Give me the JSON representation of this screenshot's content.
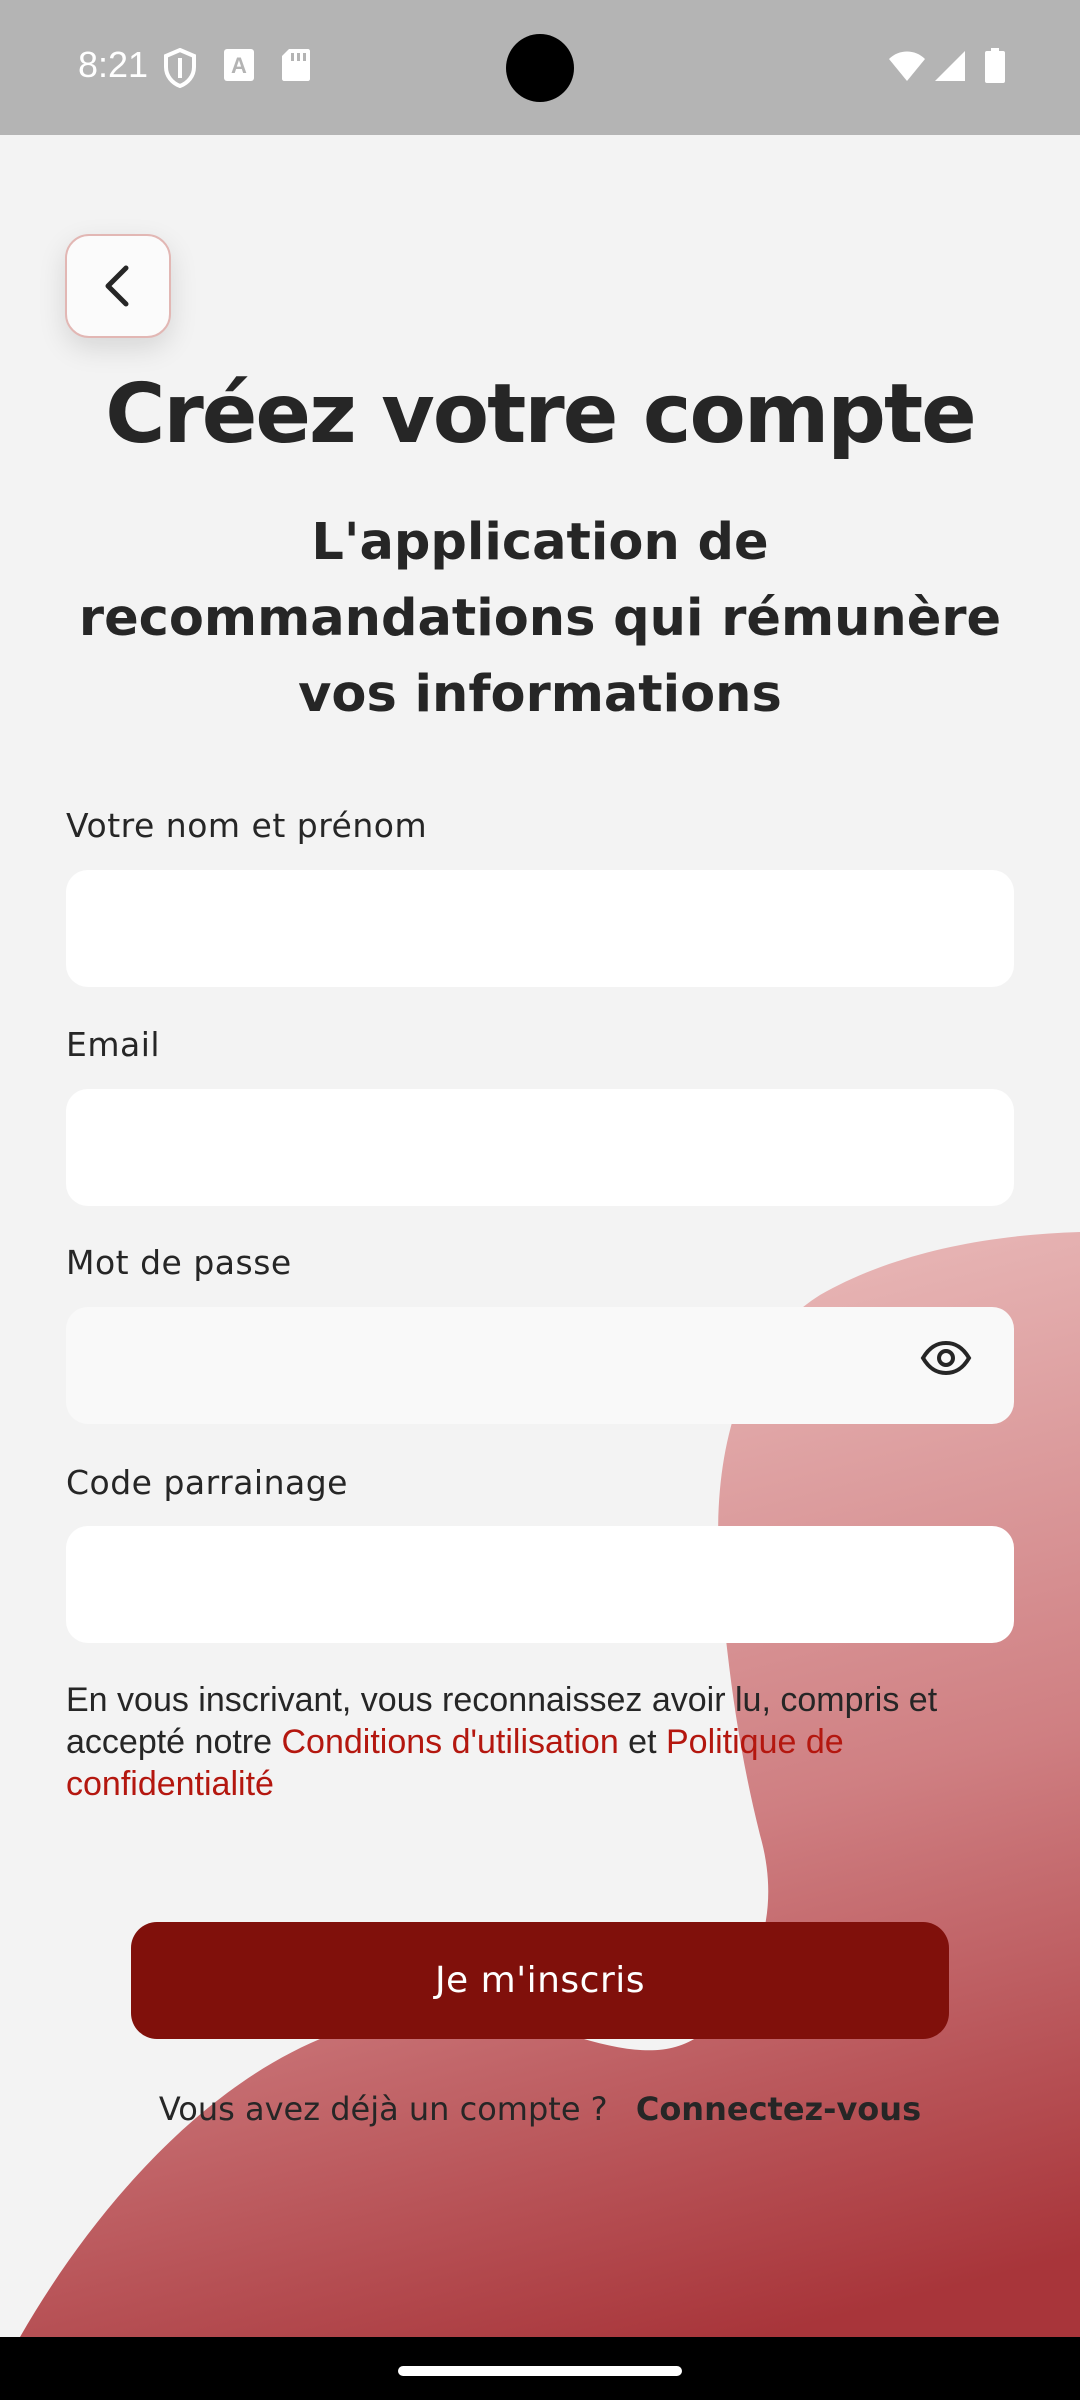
{
  "status_bar": {
    "time": "8:21",
    "left_icons": [
      "shield-icon",
      "keyboard-a-icon",
      "sd-card-icon"
    ],
    "right_icons": [
      "wifi-icon",
      "signal-icon",
      "battery-icon"
    ]
  },
  "header": {
    "back_icon": "chevron-left-icon",
    "title": "Créez votre compte",
    "subtitle": "L'application de recommandations qui rémunère vos informations"
  },
  "form": {
    "name_label": "Votre nom et prénom",
    "name_value": "",
    "email_label": "Email",
    "email_value": "",
    "password_label": "Mot de passe",
    "password_value": "",
    "password_toggle_icon": "eye-icon",
    "referral_label": "Code parrainage",
    "referral_value": ""
  },
  "terms": {
    "prefix": "En vous inscrivant, vous reconnaissez avoir lu, compris et accepté notre ",
    "conditions_link": "Conditions d'utilisation",
    "separator": " et ",
    "privacy_link": "Politique de confidentialité"
  },
  "actions": {
    "signup_label": "Je m'inscris",
    "login_prompt": "Vous avez déjà un compte ?",
    "login_link": "Connectez-vous"
  },
  "colors": {
    "primary": "#80100b",
    "link": "#b4170f",
    "background": "#f3f3f3",
    "text": "#262626",
    "blob_light": "#ecc0bf",
    "blob_dark": "#a8353a"
  }
}
